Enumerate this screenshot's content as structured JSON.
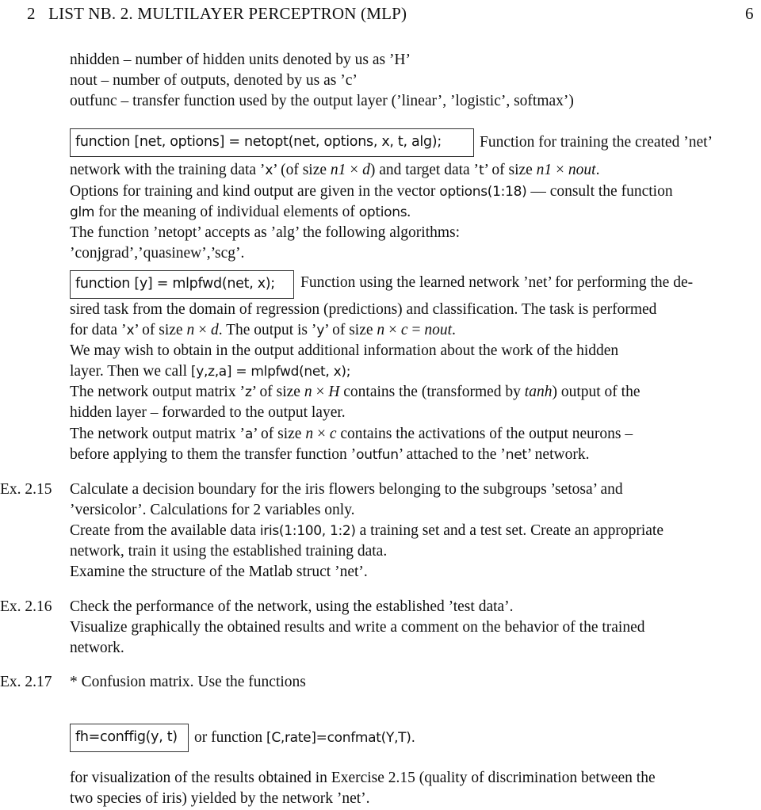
{
  "header": {
    "section_number": "2",
    "title": "LIST NB. 2. MULTILAYER PERCEPTRON (MLP)",
    "page_number": "6"
  },
  "params": [
    "nhidden – number of hidden units denoted by us as ’H’",
    "nout – number of outputs, denoted by us as ’c’",
    "outfunc – transfer function used by the output layer (’linear’, ’logistic’, softmax’)"
  ],
  "netopt": {
    "signature": "function [net, options] = netopt(net, options, x, t, alg);",
    "desc_first": "Function for training the created ’net’",
    "line2_a": "network with the training data ’",
    "line2_x": "x",
    "line2_b": "’ (of size ",
    "line2_n1": "n1",
    "line2_c": " × ",
    "line2_d": "d",
    "line2_e": ") and target data ’",
    "line2_t": "t",
    "line2_f": "’ of size ",
    "line2_n1b": "n1",
    "line2_g": " × ",
    "line2_nout": "nout",
    "line2_h": ".",
    "line3_a": "Options for training and kind output are given in the vector ",
    "line3_code": "options(1:18)",
    "line3_b": " — consult the function",
    "line4_code": "glm",
    "line4_a": " for the meaning of individual elements of ",
    "line4_code2": "options",
    "line4_b": ".",
    "line5": "The function ’netopt’ accepts as ’alg’ the following algorithms:",
    "line6": "’conjgrad’,’quasinew’,’scg’."
  },
  "mlpfwd": {
    "signature": "function [y] = mlpfwd(net, x);",
    "desc_first": "Function using the learned network ’net’ for performing the de-",
    "line2": "sired task from the domain of regression (predictions) and classification. The task is performed",
    "line3_a": "for data ’",
    "line3_x": "x",
    "line3_b": "’ of size ",
    "line3_n": "n",
    "line3_c": " × ",
    "line3_d": "d",
    "line3_e": ". The output is ’",
    "line3_y": "y",
    "line3_f": "’ of size ",
    "line3_n2": "n",
    "line3_g": " × ",
    "line3_cv": "c",
    "line3_h": " = ",
    "line3_nout": "nout",
    "line3_i": ".",
    "line4": "We may wish to obtain in the output additional information about the work of the hidden",
    "line5_a": "layer. Then we call ",
    "line5_code": "[y,z,a] = mlpfwd(net, x);",
    "line6_a": "The network output matrix ’",
    "line6_z": "z",
    "line6_b": "’ of size ",
    "line6_n": "n",
    "line6_c": " × ",
    "line6_H": "H",
    "line6_d": " contains the (transformed by ",
    "line6_tanh": "tanh",
    "line6_e": ") output of the",
    "line7": "hidden layer – forwarded to the output layer.",
    "line8_a": "The network output matrix ’",
    "line8_a_code": "a",
    "line8_b": "’ of size ",
    "line8_n": "n",
    "line8_c": " × ",
    "line8_cv": "c",
    "line8_d": " contains the activations of the output neurons –",
    "line9_a": "before applying to them the transfer function ’",
    "line9_code": "outfun",
    "line9_b": "’ attached to the ’",
    "line9_code2": "net",
    "line9_c": "’ network."
  },
  "exercises": [
    {
      "label": "Ex. 2.15",
      "line1": "Calculate a decision boundary for the iris flowers belonging to the subgroups ’setosa’ and",
      "line2": "’versicolor’. Calculations for 2 variables only.",
      "line3_a": "Create from the available data ",
      "line3_code": "iris(1:100, 1:2)",
      "line3_b": " a training set and a test set. Create an appropriate",
      "line4": "network, train it using the established training data.",
      "line5": "Examine the structure of the Matlab struct ’net’."
    },
    {
      "label": "Ex. 2.16",
      "line1": "Check the performance of the network, using the established ’test data’.",
      "line2": "Visualize graphically the obtained results and write a comment on the behavior of the trained",
      "line3": "network."
    },
    {
      "label": "Ex. 2.17",
      "line1": "* Confusion matrix. Use the functions",
      "box_code": "fh=conffig(y, t)",
      "or_text": "or function ",
      "code2": "[C,rate]=confmat(Y,T).",
      "line_after1": "for visualization of the results obtained in Exercise 2.15 (quality of discrimination between the",
      "line_after2": "two species of iris) yielded by the network ’net’."
    }
  ]
}
